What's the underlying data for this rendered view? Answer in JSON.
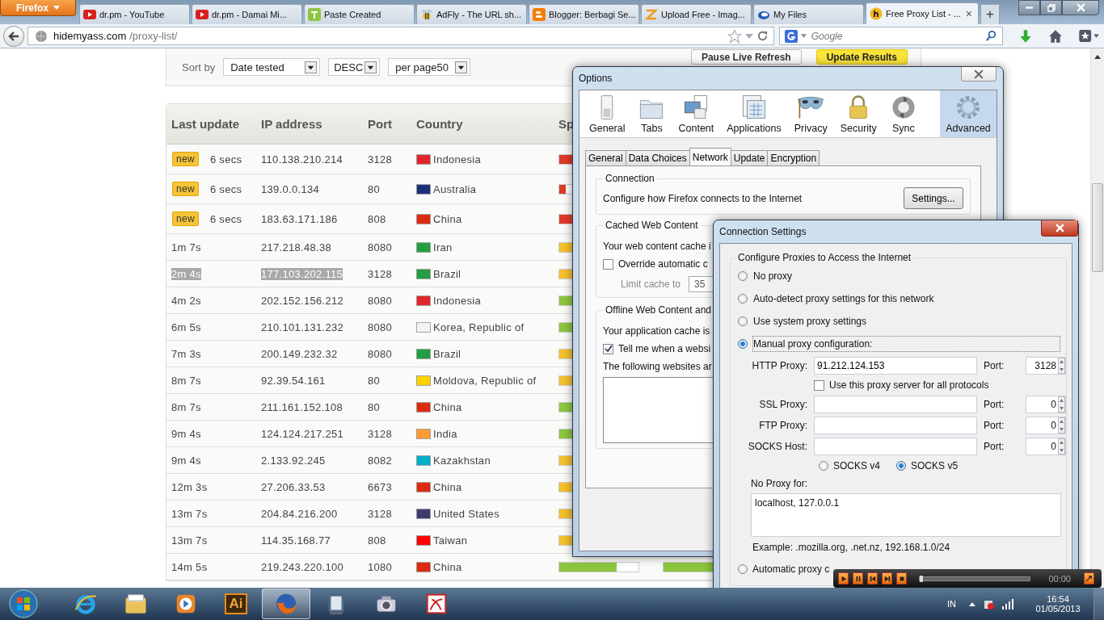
{
  "browser": {
    "menu_button": "Firefox",
    "tabs": [
      {
        "kind": "youtube",
        "title": "dr.pm - YouTube",
        "selected": false
      },
      {
        "kind": "youtube",
        "title": "dr.pm - Damai Mi...",
        "selected": false
      },
      {
        "kind": "paste",
        "title": "Paste Created",
        "selected": false
      },
      {
        "kind": "bee",
        "title": "AdFly - The URL sh...",
        "selected": false
      },
      {
        "kind": "blogger",
        "title": "Blogger: Berbagi Se...",
        "selected": false
      },
      {
        "kind": "upload",
        "title": "Upload Free - Imag...",
        "selected": false
      },
      {
        "kind": "swirl",
        "title": "My Files",
        "selected": false
      },
      {
        "kind": "letter",
        "title": "Free Proxy List - ...",
        "selected": true,
        "close": "×"
      }
    ],
    "new_tab": "+",
    "url": {
      "domain": "hidemyass.com",
      "path": "/proxy-list/"
    },
    "search": {
      "placeholder": "Google"
    }
  },
  "page": {
    "sort": {
      "label": "Sort by",
      "field": "Date tested",
      "order": "DESC",
      "per_page": "per page50"
    },
    "buttons": [
      {
        "kind": "plain",
        "label": "Pause Live Refresh"
      },
      {
        "kind": "highlight",
        "label": "Update Results"
      }
    ],
    "table": {
      "columns": [
        "Last update",
        "IP address",
        "Port",
        "Country",
        "Sp"
      ],
      "rows": [
        {
          "badge": "new",
          "time": "6 secs",
          "ip": "110.138.210.214",
          "port": "3128",
          "country": "Indonesia",
          "flag": {
            "color": "#e0262b"
          },
          "speed": {
            "color": "#e03a2a"
          },
          "highlighted": false
        },
        {
          "badge": "new",
          "time": "6 secs",
          "ip": "139.0.0.134",
          "port": "80",
          "country": "Australia",
          "flag": {
            "color": "#1b2f7a"
          },
          "speed": {
            "color": "#e03a2a",
            "level": 0.08
          },
          "highlighted": false
        },
        {
          "badge": "new",
          "time": "6 secs",
          "ip": "183.63.171.186",
          "port": "808",
          "country": "China",
          "flag": {
            "color": "#de2910"
          },
          "speed": {
            "color": "#e03a2a"
          },
          "highlighted": false
        },
        {
          "time": "1m 7s",
          "ip": "217.218.48.38",
          "port": "8080",
          "country": "Iran",
          "flag": {
            "color": "#239f40"
          },
          "speed": {
            "color": "#f5c02c"
          },
          "highlighted": false
        },
        {
          "time": "2m 4s",
          "ip": "177.103.202.115",
          "port": "3128",
          "country": "Brazil",
          "flag": {
            "color": "#229e45"
          },
          "speed": {
            "color": "#f5c02c"
          },
          "highlighted": true
        },
        {
          "time": "4m 2s",
          "ip": "202.152.156.212",
          "port": "8080",
          "country": "Indonesia",
          "flag": {
            "color": "#e0262b"
          },
          "speed": {
            "color": "#8cc63f"
          },
          "highlighted": false
        },
        {
          "time": "6m 5s",
          "ip": "210.101.131.232",
          "port": "8080",
          "country": "Korea, Republic of",
          "flag": {
            "color": "#f4f4f4"
          },
          "speed": {
            "color": "#8cc63f"
          },
          "highlighted": false
        },
        {
          "time": "7m 3s",
          "ip": "200.149.232.32",
          "port": "8080",
          "country": "Brazil",
          "flag": {
            "color": "#229e45"
          },
          "speed": {
            "color": "#f5c02c"
          },
          "highlighted": false
        },
        {
          "time": "8m 7s",
          "ip": "92.39.54.161",
          "port": "80",
          "country": "Moldova, Republic of",
          "flag": {
            "color": "#ffd200"
          },
          "speed": {
            "color": "#f5c02c"
          },
          "highlighted": false
        },
        {
          "time": "8m 7s",
          "ip": "211.161.152.108",
          "port": "80",
          "country": "China",
          "flag": {
            "color": "#de2910"
          },
          "speed": {
            "color": "#8cc63f"
          },
          "highlighted": false
        },
        {
          "time": "9m 4s",
          "ip": "124.124.217.251",
          "port": "3128",
          "country": "India",
          "flag": {
            "color": "#ff9933"
          },
          "speed": {
            "color": "#8cc63f"
          },
          "highlighted": false
        },
        {
          "time": "9m 4s",
          "ip": "2.133.92.245",
          "port": "8082",
          "country": "Kazakhstan",
          "flag": {
            "color": "#00afca"
          },
          "speed": {
            "color": "#f5c02c"
          },
          "highlighted": false
        },
        {
          "time": "12m 3s",
          "ip": "27.206.33.53",
          "port": "6673",
          "country": "China",
          "flag": {
            "color": "#de2910"
          },
          "speed": {
            "color": "#f5c02c"
          },
          "highlighted": false
        },
        {
          "time": "13m 7s",
          "ip": "204.84.216.200",
          "port": "3128",
          "country": "United States",
          "flag": {
            "color": "#3c3b6e"
          },
          "speed": {
            "color": "#f5c02c"
          },
          "highlighted": false
        },
        {
          "time": "13m 7s",
          "ip": "114.35.168.77",
          "port": "808",
          "country": "Taiwan",
          "flag": {
            "color": "#fe0000"
          },
          "speed": {
            "color": "#f5c02c"
          },
          "highlighted": false
        },
        {
          "time": "14m 5s",
          "ip": "219.243.220.100",
          "port": "1080",
          "country": "China",
          "flag": {
            "color": "#de2910"
          },
          "speed": {
            "color": "#8cc63f",
            "level": 0.72
          },
          "connection": {
            "color": "#8cc63f"
          },
          "highlighted": false
        }
      ]
    }
  },
  "options": {
    "title": "Options",
    "categories": [
      {
        "kind": "general",
        "label": "General",
        "selected": false
      },
      {
        "kind": "tabs",
        "label": "Tabs",
        "selected": false
      },
      {
        "kind": "content",
        "label": "Content",
        "selected": false
      },
      {
        "kind": "applications",
        "label": "Applications",
        "selected": false
      },
      {
        "kind": "privacy",
        "label": "Privacy",
        "selected": false
      },
      {
        "kind": "security",
        "label": "Security",
        "selected": false
      },
      {
        "kind": "sync",
        "label": "Sync",
        "selected": false
      },
      {
        "kind": "advanced",
        "label": "Advanced",
        "selected": true
      }
    ],
    "subtabs": [
      {
        "label": "General",
        "selected": false
      },
      {
        "label": "Data Choices",
        "selected": false
      },
      {
        "label": "Network",
        "selected": true
      },
      {
        "label": "Update",
        "selected": false
      },
      {
        "label": "Encryption",
        "selected": false
      }
    ],
    "connection": {
      "title": "Connection",
      "text": "Configure how Firefox connects to the Internet",
      "button": "Settings..."
    },
    "cache": {
      "title": "Cached Web Content",
      "text": "Your web content cache i",
      "override": {
        "label": "Override automatic c",
        "checked": false
      },
      "limit_label": "Limit cache to",
      "limit_value": "35"
    },
    "offline": {
      "title": "Offline Web Content and",
      "text": "Your application cache is",
      "tell": {
        "label": "Tell me when a websi",
        "checked": true
      },
      "list_label": "The following websites ar"
    }
  },
  "connection_settings": {
    "title": "Connection Settings",
    "group": "Configure Proxies to Access the Internet",
    "modes": [
      {
        "label": "No proxy",
        "selected": false
      },
      {
        "label": "Auto-detect proxy settings for this network",
        "selected": false
      },
      {
        "label": "Use system proxy settings",
        "selected": false
      },
      {
        "label": "Manual proxy configuration:",
        "selected": true
      }
    ],
    "proxies": [
      {
        "label": "HTTP Proxy:",
        "value": "91.212.124.153",
        "port_label": "Port:",
        "port": "3128"
      },
      {
        "label": "SSL Proxy:",
        "port_label": "Port:",
        "port": "0"
      },
      {
        "label": "FTP Proxy:",
        "port_label": "Port:",
        "port": "0"
      },
      {
        "label": "SOCKS Host:",
        "port_label": "Port:",
        "port": "0"
      }
    ],
    "share": {
      "label": "Use this proxy server for all protocols",
      "checked": false
    },
    "socks_versions": [
      {
        "label": "SOCKS v4",
        "selected": false
      },
      {
        "label": "SOCKS v5",
        "selected": true
      }
    ],
    "no_proxy": {
      "label": "No Proxy for:",
      "value": "localhost, 127.0.0.1"
    },
    "example": "Example: .mozilla.org, .net.nz, 192.168.1.0/24",
    "auto_url": {
      "label": "Automatic proxy c",
      "selected": false
    }
  },
  "media_player": {
    "buttons": [
      {
        "kind": "play"
      },
      {
        "kind": "pause"
      },
      {
        "kind": "previous"
      },
      {
        "kind": "next"
      },
      {
        "kind": "stop"
      }
    ],
    "seek": {
      "level": 0
    },
    "time": "00:00"
  },
  "taskbar": {
    "apps": [
      {
        "kind": "ie",
        "selected": false
      },
      {
        "kind": "explorer",
        "selected": false
      },
      {
        "kind": "media",
        "selected": false
      },
      {
        "kind": "illustrator",
        "label": "Ai",
        "selected": false
      },
      {
        "kind": "firefox",
        "selected": true
      },
      {
        "kind": "monitor",
        "selected": false
      },
      {
        "kind": "camera",
        "selected": false
      },
      {
        "kind": "pdf",
        "selected": false
      }
    ],
    "tray": {
      "language": "IN",
      "time": "16:54",
      "date": "01/05/2013"
    }
  }
}
